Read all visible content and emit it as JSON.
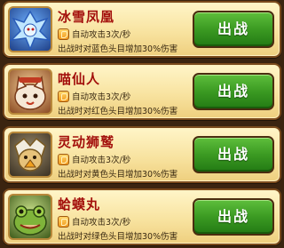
{
  "cards": [
    {
      "name": "冰雪凤凰",
      "skill": "自动攻击3次/秒",
      "bonus": "出战时对蓝色头目增加30%伤害",
      "button": "出战",
      "portrait_icon": "ice-phoenix-icon",
      "portrait_color": "#3a63c8"
    },
    {
      "name": "喵仙人",
      "skill": "自动攻击3次/秒",
      "bonus": "出战时对红色头目增加30%伤害",
      "button": "出战",
      "portrait_icon": "cat-sage-icon",
      "portrait_color": "#c23a22"
    },
    {
      "name": "灵动狮鹫",
      "skill": "自动攻击3次/秒",
      "bonus": "出战时对黄色头目增加30%伤害",
      "button": "出战",
      "portrait_icon": "griffin-icon",
      "portrait_color": "#d8a640"
    },
    {
      "name": "蛤蟆丸",
      "skill": "自动攻击3次/秒",
      "bonus": "出战时对绿色头目增加30%伤害",
      "button": "出战",
      "portrait_icon": "toad-icon",
      "portrait_color": "#5e9a2a"
    }
  ]
}
